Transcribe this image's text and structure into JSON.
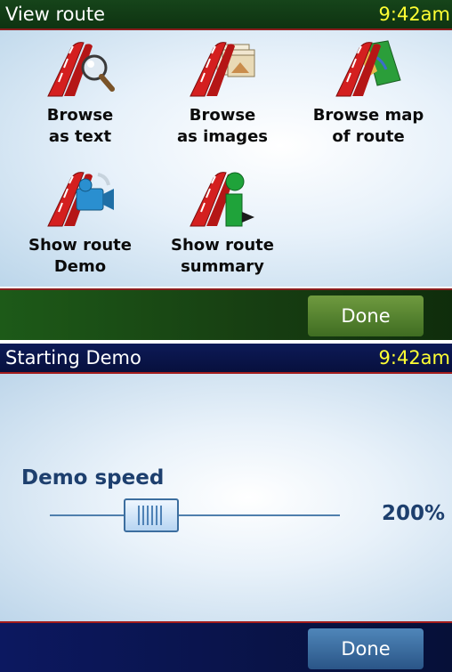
{
  "screen1": {
    "title": "View route",
    "time": "9:42am",
    "tiles": [
      {
        "label": "Browse\nas text",
        "icon": "road-magnifier-icon"
      },
      {
        "label": "Browse\nas images",
        "icon": "road-images-icon"
      },
      {
        "label": "Browse map\nof route",
        "icon": "road-map-icon"
      },
      {
        "label": "Show route\nDemo",
        "icon": "road-camera-icon"
      },
      {
        "label": "Show route\nsummary",
        "icon": "road-info-icon"
      }
    ],
    "done_label": "Done"
  },
  "screen2": {
    "title": "Starting Demo",
    "time": "9:42am",
    "slider_label": "Demo speed",
    "slider_value_text": "200%",
    "slider_position_fraction": 0.35,
    "done_label": "Done"
  },
  "colors": {
    "screen1_bar": "#16441a",
    "screen2_bar": "#0d1a57",
    "clock": "#ffff33",
    "road_red": "#d41f1f",
    "label_blue": "#1d3f6e"
  }
}
